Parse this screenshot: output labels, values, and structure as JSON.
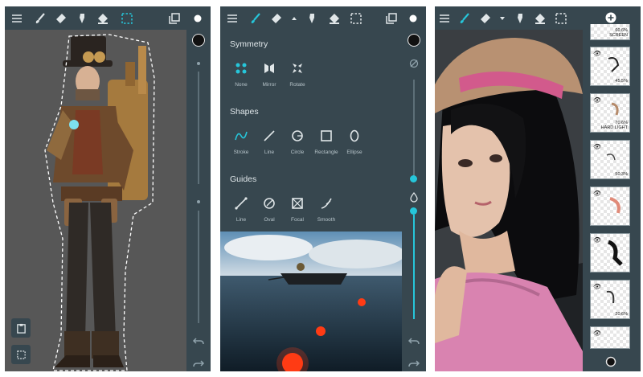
{
  "panel1": {
    "tools": [
      "menu-icon",
      "brush-icon",
      "eraser-icon",
      "smudge-icon",
      "fill-icon",
      "selection-icon",
      "layers-icon",
      "color-icon"
    ],
    "left_buttons": [
      "clipboard-icon",
      "selection-icon"
    ]
  },
  "panel2": {
    "sections": [
      {
        "title": "Symmetry",
        "options": [
          {
            "label": "None",
            "icon": "symmetry-none-icon"
          },
          {
            "label": "Mirror",
            "icon": "symmetry-mirror-icon"
          },
          {
            "label": "Rotate",
            "icon": "symmetry-rotate-icon"
          }
        ]
      },
      {
        "title": "Shapes",
        "options": [
          {
            "label": "Stroke",
            "icon": "stroke-icon"
          },
          {
            "label": "Line",
            "icon": "line-icon"
          },
          {
            "label": "Circle",
            "icon": "circle-icon"
          },
          {
            "label": "Rectangle",
            "icon": "rectangle-icon"
          },
          {
            "label": "Ellipse",
            "icon": "ellipse-icon"
          }
        ]
      },
      {
        "title": "Guides",
        "options": [
          {
            "label": "Line",
            "icon": "guide-line-icon"
          },
          {
            "label": "Oval",
            "icon": "guide-oval-icon"
          },
          {
            "label": "Focal",
            "icon": "guide-focal-icon"
          },
          {
            "label": "Smooth",
            "icon": "guide-smooth-icon"
          }
        ]
      }
    ]
  },
  "panel3": {
    "layers": [
      {
        "pct": "60.6%",
        "mode": "SCREEN"
      },
      {
        "pct": "45.5%",
        "mode": ""
      },
      {
        "pct": "70.6%",
        "mode": "HARD LIGHT"
      },
      {
        "pct": "50.3%",
        "mode": ""
      },
      {
        "pct": "",
        "mode": ""
      },
      {
        "pct": "",
        "mode": ""
      },
      {
        "pct": "20.6%",
        "mode": ""
      },
      {
        "pct": "",
        "mode": ""
      }
    ]
  },
  "colors": {
    "accent": "#26c6da",
    "toolbar": "#37474f",
    "canvas": "#535353"
  }
}
